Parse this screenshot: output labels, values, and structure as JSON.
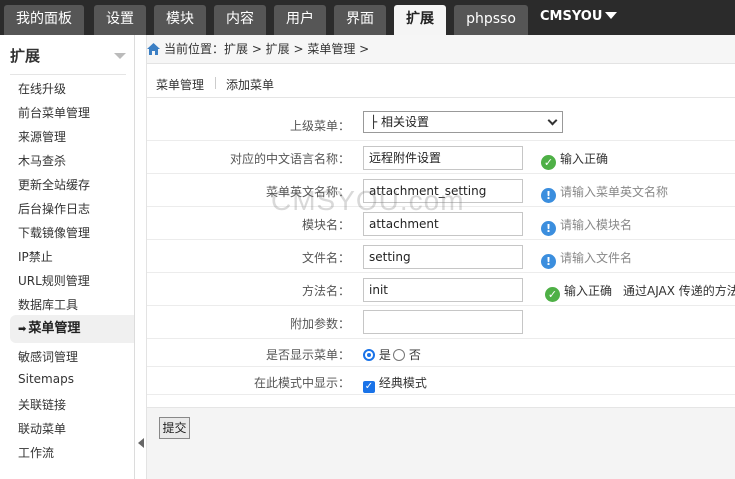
{
  "nav": {
    "tabs": [
      {
        "label": "我的面板"
      },
      {
        "label": "设置"
      },
      {
        "label": "模块"
      },
      {
        "label": "内容"
      },
      {
        "label": "用户"
      },
      {
        "label": "界面"
      },
      {
        "label": "扩展"
      },
      {
        "label": "phpsso"
      }
    ],
    "active_tab": "扩展",
    "brand": "CMSYOU"
  },
  "sidebar": {
    "title": "扩展",
    "items": [
      {
        "label": "在线升级"
      },
      {
        "label": "前台菜单管理"
      },
      {
        "label": "来源管理"
      },
      {
        "label": "木马查杀"
      },
      {
        "label": "更新全站缓存"
      },
      {
        "label": "后台操作日志"
      },
      {
        "label": "下载镜像管理"
      },
      {
        "label": "IP禁止"
      },
      {
        "label": "URL规则管理"
      },
      {
        "label": "数据库工具"
      },
      {
        "label": "菜单管理"
      },
      {
        "label": "敏感词管理"
      },
      {
        "label": "Sitemaps"
      },
      {
        "label": "关联链接"
      },
      {
        "label": "联动菜单"
      },
      {
        "label": "工作流"
      }
    ],
    "active_item": "菜单管理"
  },
  "breadcrumb": "当前位置：扩展 > 扩展 > 菜单管理 >",
  "subtabs": {
    "manage": "菜单管理",
    "add": "添加菜单"
  },
  "form": {
    "parent_menu": {
      "label": "上级菜单：",
      "value": "├ 相关设置"
    },
    "cn_name": {
      "label": "对应的中文语言名称：",
      "value": "远程附件设置",
      "tip": "输入正确"
    },
    "en_name": {
      "label": "菜单英文名称：",
      "value": "attachment_setting",
      "tip": "请输入菜单英文名称"
    },
    "module": {
      "label": "模块名：",
      "value": "attachment",
      "tip": "请输入模块名"
    },
    "file": {
      "label": "文件名：",
      "value": "setting",
      "tip": "请输入文件名"
    },
    "method": {
      "label": "方法名：",
      "value": "init",
      "tip": "输入正确",
      "extra": "通过AJAX 传递的方法"
    },
    "params": {
      "label": "附加参数：",
      "value": ""
    },
    "show_menu": {
      "label": "是否显示菜单：",
      "yes": "是",
      "no": "否",
      "selected": "是"
    },
    "mode_show": {
      "label": "在此模式中显示：",
      "option": "经典模式",
      "checked": true
    }
  },
  "submit_label": "提交",
  "watermark": "CMSYOU.com",
  "colors": {
    "topbar": "#2b2b2b",
    "tab": "#565656",
    "ok": "#4eb046",
    "info": "#3b8ede"
  }
}
